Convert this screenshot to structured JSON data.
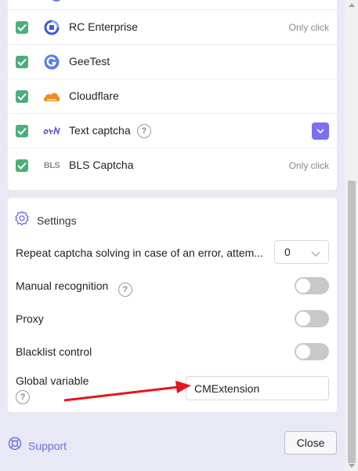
{
  "services": [
    {
      "name": "RC Enterprise",
      "icon": "rc-enterprise-logo-icon",
      "checked": true,
      "note": "Only click"
    },
    {
      "name": "GeeTest",
      "icon": "geetest-logo-icon",
      "checked": true,
      "note": ""
    },
    {
      "name": "Cloudflare",
      "icon": "cloudflare-logo-icon",
      "checked": true,
      "note": ""
    },
    {
      "name": "Text captcha",
      "icon": "text-captcha-icon",
      "checked": true,
      "help": "?",
      "note": ""
    },
    {
      "name": "BLS Captcha",
      "icon": "bls-logo-icon",
      "icon_text": "BLS",
      "checked": true,
      "note": "Only click"
    }
  ],
  "settings": {
    "title": "Settings",
    "retry_label": "Repeat captcha solving in case of an error, attem...",
    "retry_value": "0",
    "manual_label": "Manual recognition",
    "manual_help": "?",
    "manual_enabled": false,
    "proxy_label": "Proxy",
    "proxy_enabled": false,
    "blacklist_label": "Blacklist control",
    "blacklist_enabled": false,
    "global_var_label": "Global variable",
    "global_var_help": "?",
    "global_var_value": "CMExtension"
  },
  "footer": {
    "support_label": "Support",
    "close_label": "Close"
  },
  "colors": {
    "accent": "#6b6ee8",
    "checkbox": "#4caf7a",
    "dropdown": "#7b6ef0",
    "annotation": "#e8141c"
  }
}
